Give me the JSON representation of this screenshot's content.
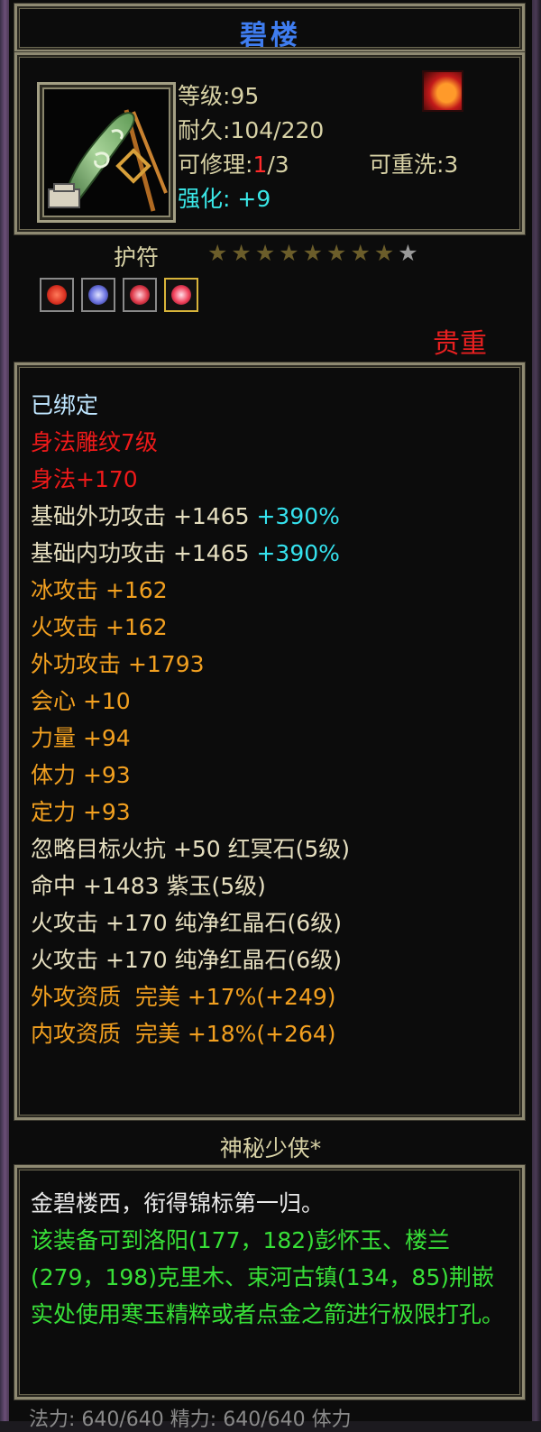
{
  "item": {
    "name": "碧楼",
    "level": "等级:95",
    "durability": "耐久:104/220",
    "repair_prefix": "可修理:",
    "repair_used": "1",
    "repair_total": "/3",
    "rewash": "可重洗:3",
    "enhance_label": "强化:",
    "enhance_value": "+9"
  },
  "talisman": {
    "label": "护符",
    "stars_on": "★★★★★★★★",
    "stars_off": "★",
    "rating": 8,
    "max": 9,
    "gem_slots": [
      {
        "icon": "red-gem-icon",
        "color": "#d83020"
      },
      {
        "icon": "blue-gem-icon",
        "color": "#6a72e0"
      },
      {
        "icon": "red-gem-icon",
        "color": "#e03a4a"
      },
      {
        "icon": "red-gem-icon",
        "color": "#f0405a"
      }
    ]
  },
  "rarity": "贵重",
  "attributes": {
    "bound": "已绑定",
    "carving": "身法雕纹7级",
    "agility": "身法+170",
    "base_ext_attack": "基础外功攻击 +1465",
    "base_ext_attack_pct": "+390%",
    "base_int_attack": "基础内功攻击 +1465",
    "base_int_attack_pct": "+390%",
    "ice_attack": "冰攻击 +162",
    "fire_attack": "火攻击 +162",
    "ext_attack": "外功攻击 +1793",
    "crit": "会心 +10",
    "strength": "力量 +94",
    "stamina": "体力 +93",
    "focus": "定力 +93",
    "ignore_fire": "忽略目标火抗 +50 红冥石(5级)",
    "hit": "命中 +1483 紫玉(5级)",
    "gem_fire_1": "火攻击 +170 纯净红晶石(6级)",
    "gem_fire_2": "火攻击 +170 纯净红晶石(6级)",
    "ext_quality": "外攻资质  完美 +17%(+249)",
    "int_quality": "内攻资质  完美 +18%(+264)"
  },
  "maker": "神秘少侠*",
  "description": {
    "flavor": "金碧楼西，衔得锦标第一归。",
    "hint": "该装备可到洛阳(177，182)彭怀玉、楼兰(279，198)克里木、束河古镇(134，85)荆嵌实处使用寒玉精粹或者点金之箭进行极限打孔。"
  },
  "bottom": "法力:  640/640   精力:  640/640   体力"
}
